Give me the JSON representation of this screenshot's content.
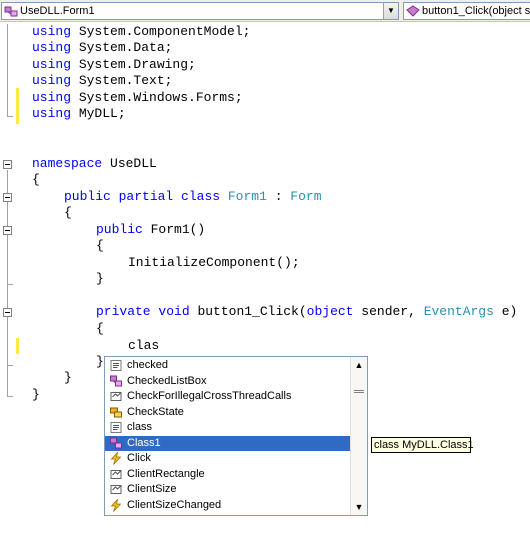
{
  "navbar": {
    "class_combo": {
      "value": "UseDLL.Form1"
    },
    "method_combo": {
      "value": "button1_Click(object s"
    }
  },
  "code": {
    "lines": {
      "l1": {
        "kw": "using",
        "rest": " System.ComponentModel;"
      },
      "l2": {
        "kw": "using",
        "rest": " System.Data;"
      },
      "l3": {
        "kw": "using",
        "rest": " System.Drawing;"
      },
      "l4": {
        "kw": "using",
        "rest": " System.Text;"
      },
      "l5": {
        "kw": "using",
        "rest": " System.Windows.Forms;"
      },
      "l6": {
        "kw": "using",
        "rest": " MyDLL;"
      },
      "l7": {
        "kw": "namespace",
        "rest": " UseDLL"
      },
      "l8": {
        "text": "{"
      },
      "l9": {
        "kw1": "public",
        "kw2": "partial",
        "kw3": "class",
        "type1": "Form1",
        "sep": " : ",
        "type2": "Form"
      },
      "l10": {
        "text": "{"
      },
      "l11": {
        "kw": "public",
        "rest": " Form1()"
      },
      "l12": {
        "text": "{"
      },
      "l13": {
        "text": "InitializeComponent();"
      },
      "l14": {
        "text": "}"
      },
      "l15": {
        "kw1": "private",
        "kw2": "void",
        "mid": " button1_Click(",
        "kw3": "object",
        "mid2": " sender, ",
        "type": "EventArgs",
        "end": " e)"
      },
      "l16": {
        "text": "{"
      },
      "l17": {
        "text": "clas"
      },
      "l18": {
        "text": "}"
      },
      "l19": {
        "text": "}"
      },
      "l20": {
        "text": "}"
      }
    }
  },
  "intellisense": {
    "items": [
      {
        "label": "checked",
        "icon": "keyword-icon"
      },
      {
        "label": "CheckedListBox",
        "icon": "class-icon"
      },
      {
        "label": "CheckForIllegalCrossThreadCalls",
        "icon": "property-icon"
      },
      {
        "label": "CheckState",
        "icon": "enum-icon"
      },
      {
        "label": "class",
        "icon": "keyword-icon"
      },
      {
        "label": "Class1",
        "icon": "class-icon"
      },
      {
        "label": "Click",
        "icon": "event-icon"
      },
      {
        "label": "ClientRectangle",
        "icon": "property-icon"
      },
      {
        "label": "ClientSize",
        "icon": "property-icon"
      },
      {
        "label": "ClientSizeChanged",
        "icon": "event-icon"
      }
    ],
    "selected_index": 5,
    "tooltip": "class MyDLL.Class1"
  },
  "colors": {
    "keyword": "#0000ff",
    "type": "#2b91af",
    "selection": "#316ac5",
    "change_bar": "#ffeb3b"
  }
}
